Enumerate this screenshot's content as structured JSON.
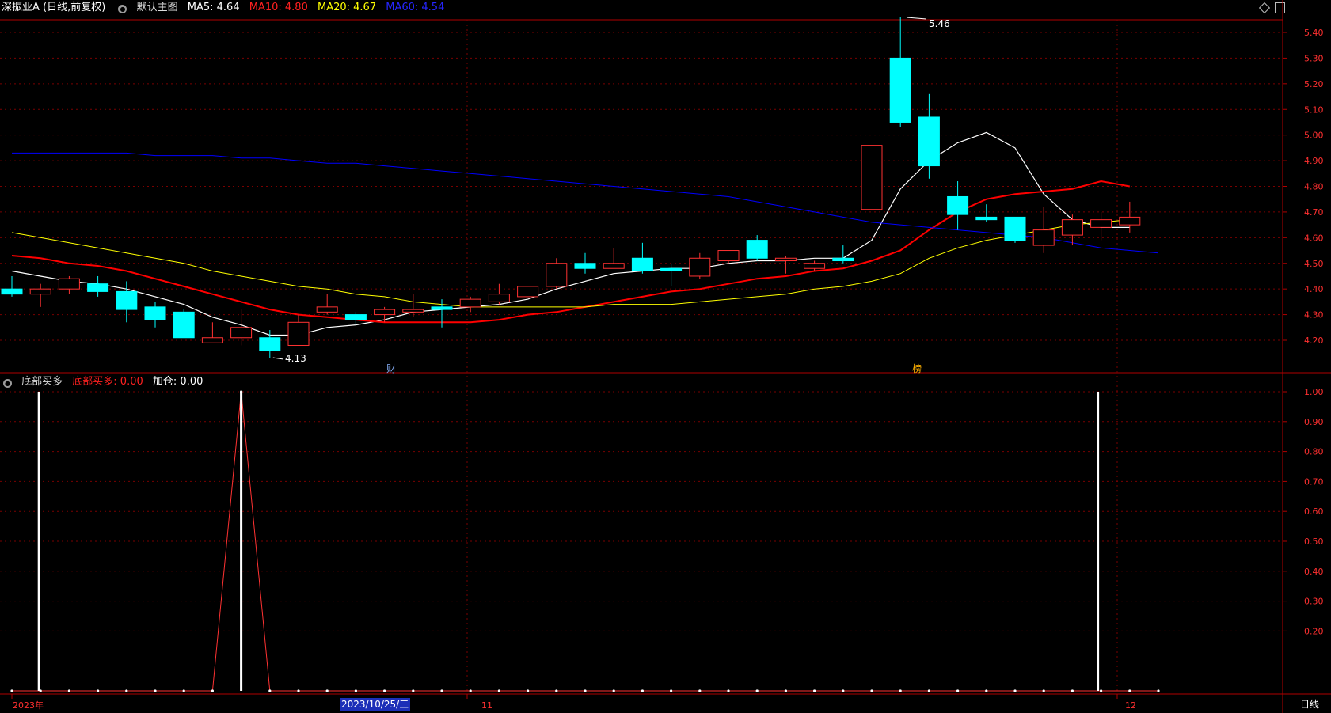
{
  "header": {
    "stock_title": "深振业A (日线,前复权)",
    "main_chart_label": "默认主图",
    "ma5": "MA5: 4.64",
    "ma10": "MA10: 4.80",
    "ma20": "MA20: 4.67",
    "ma60": "MA60: 4.54"
  },
  "indicator_header": {
    "name": "底部买多",
    "value1": "底部买多: 0.00",
    "value2": "加仓: 0.00"
  },
  "colors": {
    "up": "#ff3232",
    "down": "#00ffff",
    "ma5": "#ffffff",
    "ma10": "#ff0000",
    "ma20": "#ffff00",
    "ma60": "#0000ff",
    "grid": "#7a0000",
    "axis": "#b00000"
  },
  "markers": {
    "high": "5.46",
    "low": "4.13",
    "fin_icon": "财",
    "list_icon": "榜"
  },
  "xaxis": {
    "year": "2023年",
    "date_highlight": "2023/10/25/三",
    "nov": "11",
    "dec": "12",
    "period": "日线"
  },
  "chart_data": [
    {
      "type": "candlestick",
      "title": "深振业A (日线,前复权)",
      "ylim": [
        4.08,
        5.52
      ],
      "yticks": [
        "5.40",
        "5.30",
        "5.20",
        "5.10",
        "5.00",
        "4.90",
        "4.80",
        "4.70",
        "4.60",
        "4.50",
        "4.40",
        "4.30",
        "4.20"
      ],
      "candles": [
        {
          "o": 4.4,
          "c": 4.38,
          "h": 4.45,
          "l": 4.37
        },
        {
          "o": 4.38,
          "c": 4.4,
          "h": 4.42,
          "l": 4.33
        },
        {
          "o": 4.4,
          "c": 4.44,
          "h": 4.45,
          "l": 4.38
        },
        {
          "o": 4.42,
          "c": 4.39,
          "h": 4.45,
          "l": 4.37
        },
        {
          "o": 4.39,
          "c": 4.32,
          "h": 4.43,
          "l": 4.27
        },
        {
          "o": 4.33,
          "c": 4.28,
          "h": 4.35,
          "l": 4.25
        },
        {
          "o": 4.31,
          "c": 4.21,
          "h": 4.32,
          "l": 4.21
        },
        {
          "o": 4.19,
          "c": 4.21,
          "h": 4.27,
          "l": 4.19
        },
        {
          "o": 4.21,
          "c": 4.25,
          "h": 4.32,
          "l": 4.18
        },
        {
          "o": 4.21,
          "c": 4.16,
          "h": 4.24,
          "l": 4.13
        },
        {
          "o": 4.18,
          "c": 4.27,
          "h": 4.3,
          "l": 4.18
        },
        {
          "o": 4.31,
          "c": 4.33,
          "h": 4.38,
          "l": 4.3
        },
        {
          "o": 4.3,
          "c": 4.28,
          "h": 4.31,
          "l": 4.26
        },
        {
          "o": 4.3,
          "c": 4.32,
          "h": 4.33,
          "l": 4.27
        },
        {
          "o": 4.31,
          "c": 4.32,
          "h": 4.38,
          "l": 4.29
        },
        {
          "o": 4.33,
          "c": 4.32,
          "h": 4.36,
          "l": 4.25
        },
        {
          "o": 4.33,
          "c": 4.36,
          "h": 4.37,
          "l": 4.31
        },
        {
          "o": 4.35,
          "c": 4.38,
          "h": 4.42,
          "l": 4.34
        },
        {
          "o": 4.37,
          "c": 4.41,
          "h": 4.41,
          "l": 4.37
        },
        {
          "o": 4.41,
          "c": 4.5,
          "h": 4.52,
          "l": 4.4
        },
        {
          "o": 4.5,
          "c": 4.48,
          "h": 4.54,
          "l": 4.46
        },
        {
          "o": 4.48,
          "c": 4.5,
          "h": 4.56,
          "l": 4.48
        },
        {
          "o": 4.52,
          "c": 4.47,
          "h": 4.58,
          "l": 4.46
        },
        {
          "o": 4.48,
          "c": 4.47,
          "h": 4.5,
          "l": 4.41
        },
        {
          "o": 4.45,
          "c": 4.52,
          "h": 4.54,
          "l": 4.44
        },
        {
          "o": 4.51,
          "c": 4.55,
          "h": 4.55,
          "l": 4.5
        },
        {
          "o": 4.59,
          "c": 4.52,
          "h": 4.61,
          "l": 4.51
        },
        {
          "o": 4.51,
          "c": 4.52,
          "h": 4.53,
          "l": 4.46
        },
        {
          "o": 4.48,
          "c": 4.5,
          "h": 4.51,
          "l": 4.47
        },
        {
          "o": 4.52,
          "c": 4.51,
          "h": 4.57,
          "l": 4.5
        },
        {
          "o": 4.71,
          "c": 4.96,
          "h": 4.96,
          "l": 4.71
        },
        {
          "o": 5.3,
          "c": 5.05,
          "h": 5.46,
          "l": 5.03
        },
        {
          "o": 5.07,
          "c": 4.88,
          "h": 5.16,
          "l": 4.83
        },
        {
          "o": 4.76,
          "c": 4.69,
          "h": 4.82,
          "l": 4.63
        },
        {
          "o": 4.68,
          "c": 4.67,
          "h": 4.73,
          "l": 4.66
        },
        {
          "o": 4.68,
          "c": 4.59,
          "h": 4.68,
          "l": 4.58
        },
        {
          "o": 4.57,
          "c": 4.63,
          "h": 4.72,
          "l": 4.54
        },
        {
          "o": 4.61,
          "c": 4.67,
          "h": 4.69,
          "l": 4.57
        },
        {
          "o": 4.64,
          "c": 4.67,
          "h": 4.7,
          "l": 4.59
        },
        {
          "o": 4.65,
          "c": 4.68,
          "h": 4.74,
          "l": 4.62
        }
      ],
      "series": [
        {
          "name": "MA5",
          "values": [
            4.47,
            4.45,
            4.43,
            4.42,
            4.4,
            4.37,
            4.34,
            4.29,
            4.26,
            4.22,
            4.22,
            4.25,
            4.26,
            4.28,
            4.31,
            4.32,
            4.33,
            4.34,
            4.36,
            4.4,
            4.43,
            4.46,
            4.47,
            4.48,
            4.48,
            4.5,
            4.51,
            4.51,
            4.52,
            4.52,
            4.59,
            4.79,
            4.9,
            4.97,
            5.01,
            4.95,
            4.77,
            4.67,
            4.64,
            4.64
          ]
        },
        {
          "name": "MA10",
          "values": [
            4.53,
            4.52,
            4.5,
            4.49,
            4.47,
            4.44,
            4.41,
            4.38,
            4.35,
            4.32,
            4.3,
            4.29,
            4.28,
            4.27,
            4.27,
            4.27,
            4.27,
            4.28,
            4.3,
            4.31,
            4.33,
            4.35,
            4.37,
            4.39,
            4.4,
            4.42,
            4.44,
            4.45,
            4.47,
            4.48,
            4.51,
            4.55,
            4.63,
            4.7,
            4.75,
            4.77,
            4.78,
            4.79,
            4.82,
            4.8
          ]
        },
        {
          "name": "MA20",
          "values": [
            4.62,
            4.6,
            4.58,
            4.56,
            4.54,
            4.52,
            4.5,
            4.47,
            4.45,
            4.43,
            4.41,
            4.4,
            4.38,
            4.37,
            4.35,
            4.34,
            4.33,
            4.33,
            4.33,
            4.33,
            4.33,
            4.34,
            4.34,
            4.34,
            4.35,
            4.36,
            4.37,
            4.38,
            4.4,
            4.41,
            4.43,
            4.46,
            4.52,
            4.56,
            4.59,
            4.61,
            4.63,
            4.65,
            4.66,
            4.67
          ]
        },
        {
          "name": "MA60",
          "values": [
            4.93,
            4.93,
            4.93,
            4.93,
            4.93,
            4.92,
            4.92,
            4.92,
            4.91,
            4.91,
            4.9,
            4.89,
            4.89,
            4.88,
            4.87,
            4.86,
            4.85,
            4.84,
            4.83,
            4.82,
            4.81,
            4.8,
            4.79,
            4.78,
            4.77,
            4.76,
            4.74,
            4.72,
            4.7,
            4.68,
            4.66,
            4.65,
            4.64,
            4.63,
            4.62,
            4.61,
            4.6,
            4.58,
            4.56,
            4.55,
            4.54
          ]
        }
      ]
    },
    {
      "type": "line",
      "title": "底部买多",
      "ylim": [
        0,
        1.04
      ],
      "yticks": [
        "1.00",
        "0.90",
        "0.80",
        "0.70",
        "0.60",
        "0.50",
        "0.40",
        "0.30",
        "0.20"
      ],
      "series": [
        {
          "name": "底部买多",
          "values": [
            0,
            0,
            0,
            0,
            0,
            0,
            0,
            0,
            1,
            0,
            0,
            0,
            0,
            0,
            0,
            0,
            0,
            0,
            0,
            0,
            0,
            0,
            0,
            0,
            0,
            0,
            0,
            0,
            0,
            0,
            0,
            0,
            0,
            0,
            0,
            0,
            0,
            0,
            0,
            0,
            0
          ]
        },
        {
          "name": "加仓",
          "bar_indices": [
            1,
            8,
            38
          ]
        }
      ]
    }
  ]
}
